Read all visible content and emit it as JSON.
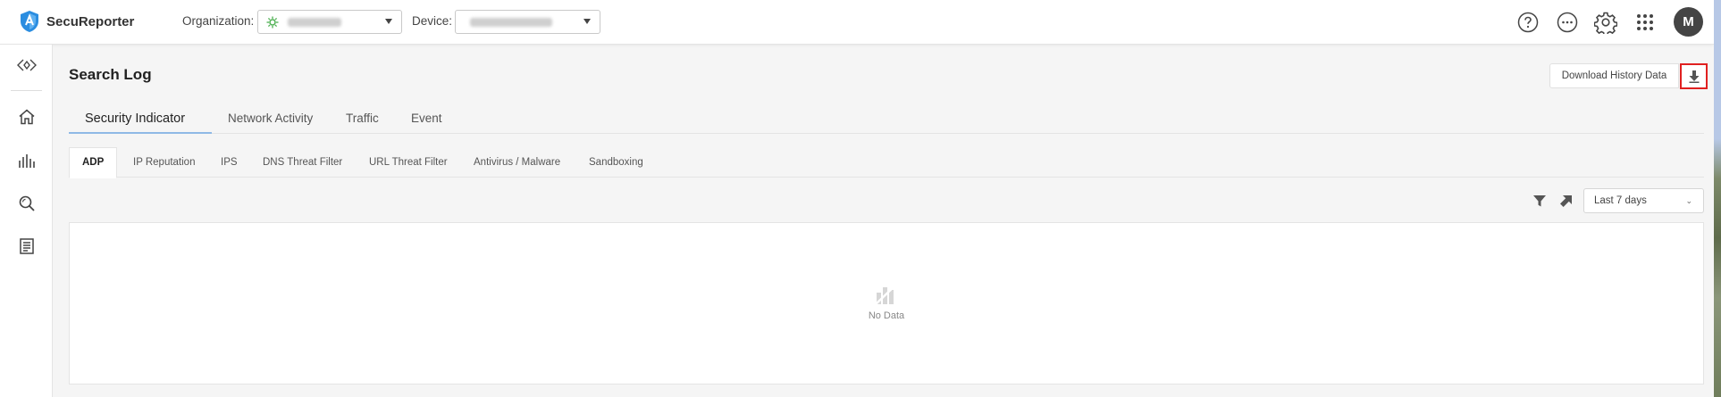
{
  "app": {
    "name": "SecuReporter"
  },
  "header": {
    "organization_label": "Organization:",
    "device_label": "Device:",
    "icons": [
      "help-icon",
      "chat-icon",
      "settings-icon",
      "apps-grid-icon"
    ],
    "avatar_initial": "M"
  },
  "sidebar": {
    "items": [
      "collapse-icon",
      "home-icon",
      "analytics-icon",
      "search-icon",
      "report-icon"
    ]
  },
  "page": {
    "title": "Search Log",
    "download_label": "Download History Data"
  },
  "tabs": [
    {
      "label": "Security Indicator",
      "active": true
    },
    {
      "label": "Network Activity",
      "active": false
    },
    {
      "label": "Traffic",
      "active": false
    },
    {
      "label": "Event",
      "active": false
    }
  ],
  "subtabs": [
    {
      "label": "ADP",
      "active": true
    },
    {
      "label": "IP Reputation",
      "active": false
    },
    {
      "label": "IPS",
      "active": false
    },
    {
      "label": "DNS Threat Filter",
      "active": false
    },
    {
      "label": "URL Threat Filter",
      "active": false
    },
    {
      "label": "Antivirus / Malware",
      "active": false
    },
    {
      "label": "Sandboxing",
      "active": false
    }
  ],
  "toolbar": {
    "range_value": "Last 7 days"
  },
  "empty": {
    "text": "No Data"
  },
  "colors": {
    "accent_underline": "#8fb9e6",
    "highlight_box": "#e02020",
    "logo_blue": "#2b8de0"
  }
}
